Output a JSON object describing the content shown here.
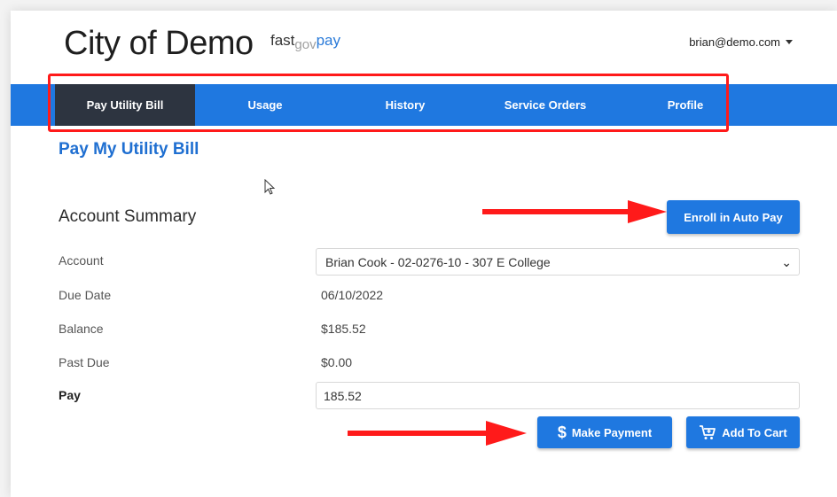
{
  "header": {
    "city_title": "City of Demo",
    "brand_part1": "fast",
    "brand_part2": "gov",
    "brand_part3": "pay",
    "user_email": "brian@demo.com"
  },
  "nav": {
    "items": [
      {
        "label": "Pay Utility Bill",
        "active": true
      },
      {
        "label": "Usage",
        "active": false
      },
      {
        "label": "History",
        "active": false
      },
      {
        "label": "Service Orders",
        "active": false
      },
      {
        "label": "Profile",
        "active": false
      }
    ]
  },
  "page": {
    "title": "Pay My Utility Bill",
    "section_title": "Account Summary",
    "enroll_button": "Enroll in Auto Pay"
  },
  "summary": {
    "account_label": "Account",
    "account_value": "Brian Cook - 02-0276-10 - 307 E College",
    "due_date_label": "Due Date",
    "due_date_value": "06/10/2022",
    "balance_label": "Balance",
    "balance_value": "$185.52",
    "past_due_label": "Past Due",
    "past_due_value": "$0.00",
    "pay_label": "Pay",
    "pay_value": "185.52"
  },
  "actions": {
    "make_payment": "Make Payment",
    "add_to_cart": "Add To Cart"
  },
  "icons": {
    "dollar": "dollar-icon",
    "cart": "cart-icon",
    "chevron": "chevron-down-icon"
  },
  "colors": {
    "nav_bg": "#1f78e0",
    "nav_active": "#2d3440",
    "title_blue": "#1f6fd1",
    "annotation_red": "#ff1a1a"
  }
}
